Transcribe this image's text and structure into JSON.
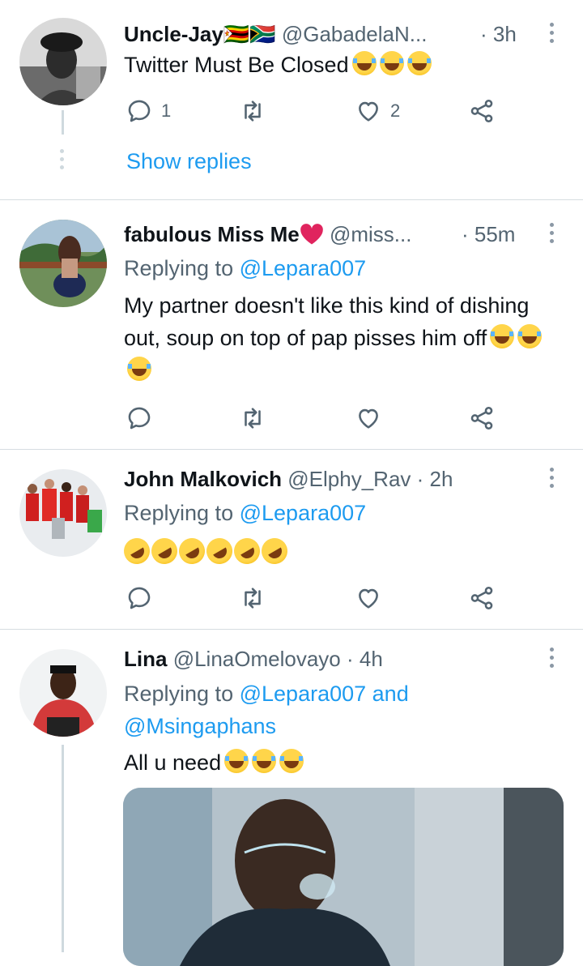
{
  "tweets": [
    {
      "name": "Uncle-Jay",
      "flags": "🇿🇼🇿🇦",
      "handle": "@GabadelaN...",
      "time": "· 3h",
      "text": "Twitter Must Be Closed",
      "reply_count": "1",
      "like_count": "2",
      "show_replies": "Show replies"
    },
    {
      "name": "fabulous Miss Me",
      "handle": "@miss...",
      "time": "· 55m",
      "replying_to_label": "Replying to",
      "replying_to": "@Lepara007",
      "text": "My partner doesn't like this kind of dishing out, soup on top of pap pisses him off"
    },
    {
      "name": "John Malkovich",
      "handle": "@Elphy_Rav",
      "time": "· 2h",
      "replying_to_label": "Replying to",
      "replying_to": "@Lepara007"
    },
    {
      "name": "Lina",
      "handle": "@LinaOmelovayo",
      "time": "· 4h",
      "replying_to_label": "Replying to",
      "replying_to": "@Lepara007",
      "and_label": "and",
      "replying_to_2": "@Msingaphans",
      "text": "All u need"
    }
  ],
  "icons": {
    "reply": "reply-icon",
    "retweet": "retweet-icon",
    "like": "heart-icon",
    "share": "share-icon",
    "more": "more-icon"
  },
  "colors": {
    "accent": "#1d9bf0",
    "secondary_text": "#536471",
    "heart_emoji": "#e0245e"
  }
}
